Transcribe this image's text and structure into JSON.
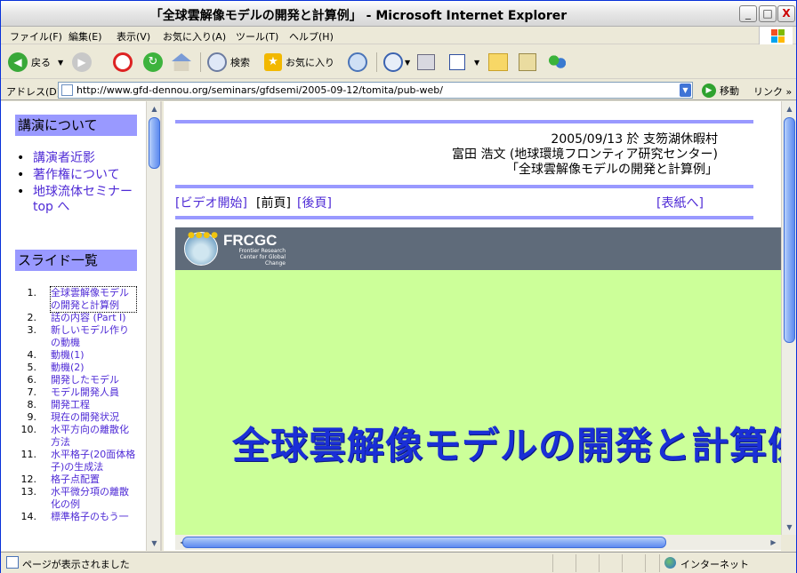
{
  "window": {
    "title": "「全球雲解像モデルの開発と計算例」 - Microsoft Internet Explorer",
    "controls": {
      "minimize": "_",
      "maximize": "□",
      "close": "X"
    }
  },
  "menu": [
    "ファイル(F)",
    "編集(E)",
    "表示(V)",
    "お気に入り(A)",
    "ツール(T)",
    "ヘルプ(H)"
  ],
  "toolbar": {
    "back_label": "戻る",
    "search_label": "検索",
    "favorites_label": "お気に入り"
  },
  "address": {
    "label": "アドレス(D)",
    "url": "http://www.gfd-dennou.org/seminars/gfdsemi/2005-09-12/tomita/pub-web/",
    "go_label": "移動",
    "links_label": "リンク »"
  },
  "left": {
    "about_heading": "講演について",
    "about_items": [
      "講演者近影",
      "著作権について",
      "地球流体セミナー top へ"
    ],
    "slides_heading": "スライド一覧",
    "slides": [
      {
        "num": "1.",
        "title": "全球雲解像モデルの開発と計算例"
      },
      {
        "num": "2.",
        "title": "話の内容 (Part I)"
      },
      {
        "num": "3.",
        "title": "新しいモデル作りの動機"
      },
      {
        "num": "4.",
        "title": "動機(1)"
      },
      {
        "num": "5.",
        "title": "動機(2)"
      },
      {
        "num": "6.",
        "title": "開発したモデル"
      },
      {
        "num": "7.",
        "title": "モデル開発人員"
      },
      {
        "num": "8.",
        "title": "開発工程"
      },
      {
        "num": "9.",
        "title": "現在の開発状況"
      },
      {
        "num": "10.",
        "title": "水平方向の離散化方法"
      },
      {
        "num": "11.",
        "title": "水平格子(20面体格子)の生成法"
      },
      {
        "num": "12.",
        "title": "格子点配置"
      },
      {
        "num": "13.",
        "title": "水平微分項の離散化の例"
      },
      {
        "num": "14.",
        "title": "標準格子のもう一"
      }
    ]
  },
  "right": {
    "date_line": "2005/09/13 於 支笏湖休暇村",
    "author_line": "富田 浩文 (地球環境フロンティア研究センター)",
    "title_line": "「全球雲解像モデルの開発と計算例」",
    "nav": {
      "video": "[ビデオ開始]",
      "prev": "[前頁]",
      "next": "[後頁]",
      "cover": "[表紙へ]"
    },
    "slide": {
      "logo_text": "FRCGC",
      "logo_sub": "Frontier Research Center for Global Change",
      "title": "全球雲解像モデルの開発と計算例"
    }
  },
  "status": {
    "text": "ページが表示されました",
    "zone": "インターネット"
  },
  "colors": {
    "section_bg": "#9999ff",
    "link": "#4f2bd6",
    "slide_bg": "#ccff99",
    "slide_title": "#1a2fd6"
  }
}
